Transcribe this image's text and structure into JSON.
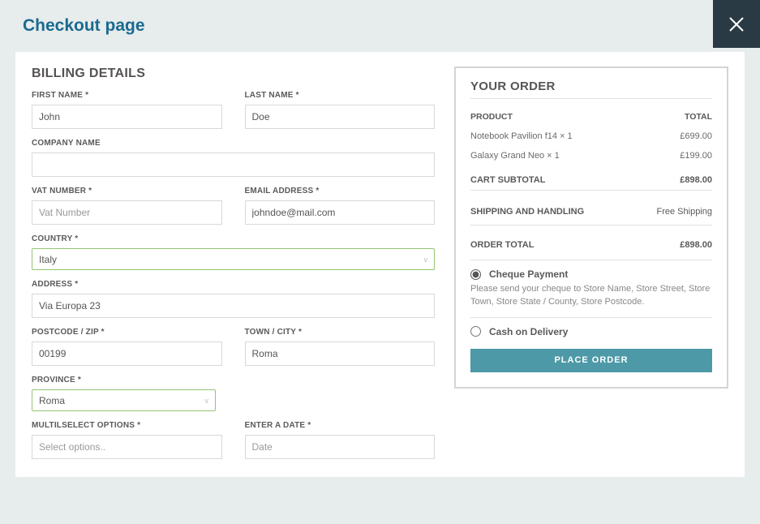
{
  "page_title": "Checkout page",
  "billing": {
    "heading": "BILLING DETAILS",
    "first_name": {
      "label": "FIRST NAME",
      "value": "John"
    },
    "last_name": {
      "label": "LAST NAME",
      "value": "Doe"
    },
    "company": {
      "label": "COMPANY NAME",
      "value": ""
    },
    "vat": {
      "label": "VAT NUMBER",
      "placeholder": "Vat Number",
      "value": ""
    },
    "email": {
      "label": "EMAIL ADDRESS",
      "value": "johndoe@mail.com"
    },
    "country": {
      "label": "COUNTRY",
      "value": "Italy"
    },
    "address": {
      "label": "ADDRESS",
      "value": "Via Europa 23"
    },
    "postcode": {
      "label": "POSTCODE / ZIP",
      "value": "00199"
    },
    "city": {
      "label": "TOWN / CITY",
      "value": "Roma"
    },
    "province": {
      "label": "PROVINCE",
      "value": "Roma"
    },
    "multiselect": {
      "label": "MULTILSELECT OPTIONS",
      "placeholder": "Select options..",
      "value": ""
    },
    "date": {
      "label": "ENTER A DATE",
      "placeholder": "Date",
      "value": ""
    }
  },
  "order": {
    "heading": "YOUR ORDER",
    "head_product": "PRODUCT",
    "head_total": "TOTAL",
    "items": [
      {
        "name": "Notebook Pavilion f14 × 1",
        "price": "£699.00"
      },
      {
        "name": "Galaxy Grand Neo × 1",
        "price": "£199.00"
      }
    ],
    "subtotal_label": "CART SUBTOTAL",
    "subtotal": "£898.00",
    "shipping_label": "SHIPPING AND HANDLING",
    "shipping": "Free Shipping",
    "total_label": "ORDER TOTAL",
    "total": "£898.00",
    "payment": {
      "cheque_label": "Cheque Payment",
      "cheque_desc": "Please send your cheque to Store Name, Store Street, Store Town, Store State / County, Store Postcode.",
      "cod_label": "Cash on Delivery"
    },
    "place_order_label": "PLACE ORDER"
  }
}
